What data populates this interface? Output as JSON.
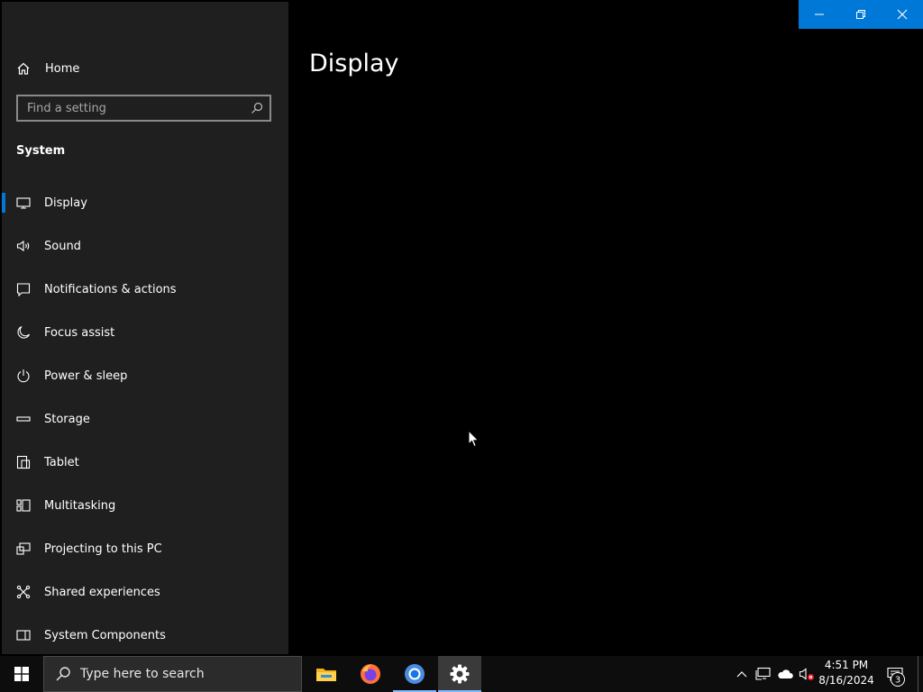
{
  "window": {
    "sidebar": {
      "home_label": "Home",
      "search_placeholder": "Find a setting",
      "section_title": "System",
      "items": [
        {
          "label": "Display",
          "icon": "monitor-icon",
          "active": true
        },
        {
          "label": "Sound",
          "icon": "speaker-icon"
        },
        {
          "label": "Notifications & actions",
          "icon": "notification-icon"
        },
        {
          "label": "Focus assist",
          "icon": "moon-icon"
        },
        {
          "label": "Power & sleep",
          "icon": "power-icon"
        },
        {
          "label": "Storage",
          "icon": "storage-icon"
        },
        {
          "label": "Tablet",
          "icon": "tablet-icon"
        },
        {
          "label": "Multitasking",
          "icon": "multitasking-icon"
        },
        {
          "label": "Projecting to this PC",
          "icon": "projecting-icon"
        },
        {
          "label": "Shared experiences",
          "icon": "shared-experiences-icon"
        },
        {
          "label": "System Components",
          "icon": "system-components-icon"
        }
      ]
    },
    "page_title": "Display",
    "caption_buttons": [
      "minimize-icon",
      "restore-icon",
      "close-icon"
    ],
    "accent_color": "#0078d7"
  },
  "taskbar": {
    "search_placeholder": "Type here to search",
    "apps": [
      "file-explorer-icon",
      "firefox-icon",
      "chrome-icon",
      "settings-gear-icon"
    ],
    "clock": {
      "time": "4:51 PM",
      "date": "8/16/2024"
    },
    "notification_count": "3"
  }
}
